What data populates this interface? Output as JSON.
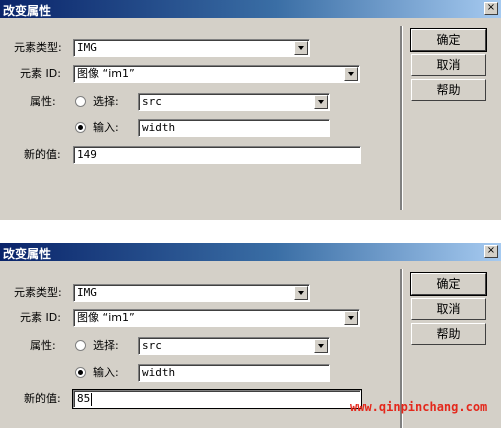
{
  "dialogs": [
    {
      "title": "改变属性",
      "close_label": "×",
      "element_type_label": "元素类型:",
      "element_type_value": "IMG",
      "element_id_label": "元素 ID:",
      "element_id_value": "图像 “im1”",
      "attribute_label": "属性:",
      "select_radio_label": "选择:",
      "select_value": "src",
      "input_radio_label": "输入:",
      "input_value": "width",
      "new_value_label": "新的值:",
      "new_value": "149",
      "ok_label": "确定",
      "cancel_label": "取消",
      "help_label": "帮助"
    },
    {
      "title": "改变属性",
      "close_label": "×",
      "element_type_label": "元素类型:",
      "element_type_value": "IMG",
      "element_id_label": "元素 ID:",
      "element_id_value": "图像 “im1”",
      "attribute_label": "属性:",
      "select_radio_label": "选择:",
      "select_value": "src",
      "input_radio_label": "输入:",
      "input_value": "width",
      "new_value_label": "新的值:",
      "new_value": "85",
      "ok_label": "确定",
      "cancel_label": "取消",
      "help_label": "帮助"
    }
  ],
  "watermark": "www.qinpinchang.com",
  "colors": {
    "dialog_bg": "#d4d0c8",
    "title_start": "#0a246a",
    "watermark": "#e4281c"
  }
}
